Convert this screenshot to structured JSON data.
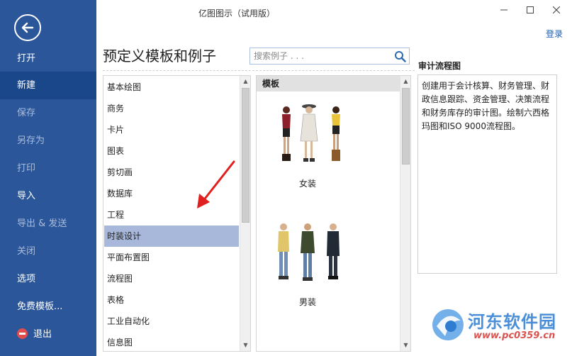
{
  "window": {
    "title": "亿图图示（试用版）",
    "login": "登录"
  },
  "sidebar": {
    "items": [
      {
        "label": "打开"
      },
      {
        "label": "新建"
      },
      {
        "label": "保存"
      },
      {
        "label": "另存为"
      },
      {
        "label": "打印"
      },
      {
        "label": "导入"
      },
      {
        "label": "导出 & 发送"
      },
      {
        "label": "关闭"
      },
      {
        "label": "选项"
      },
      {
        "label": "免费模板..."
      },
      {
        "label": "退出"
      }
    ]
  },
  "main": {
    "heading": "预定义模板和例子",
    "search": {
      "placeholder": "搜索例子 . . ."
    }
  },
  "categories": {
    "items": [
      {
        "label": "基本绘图"
      },
      {
        "label": "商务"
      },
      {
        "label": "卡片"
      },
      {
        "label": "图表"
      },
      {
        "label": "剪切画"
      },
      {
        "label": "数据库"
      },
      {
        "label": "工程"
      },
      {
        "label": "时装设计"
      },
      {
        "label": "平面布置图"
      },
      {
        "label": "流程图"
      },
      {
        "label": "表格"
      },
      {
        "label": "工业自动化"
      },
      {
        "label": "信息图"
      }
    ],
    "selected": "时装设计"
  },
  "templates": {
    "header": "模板",
    "items": [
      {
        "label": "女装"
      },
      {
        "label": "男装"
      }
    ]
  },
  "description": {
    "title": "审计流程图",
    "text": "创建用于会计核算、财务管理、财政信息跟踪、资金管理、决策流程和财务库存的审计图。绘制六西格玛图和ISO 9000流程图。"
  },
  "watermark": {
    "site_name": "河东软件园",
    "url": "www.pc0359.cn"
  },
  "colors": {
    "sidebar_bg": "#2b579a",
    "sidebar_active": "#19478a",
    "selected_row": "#a7b8db",
    "annotation_arrow": "#e02020"
  }
}
